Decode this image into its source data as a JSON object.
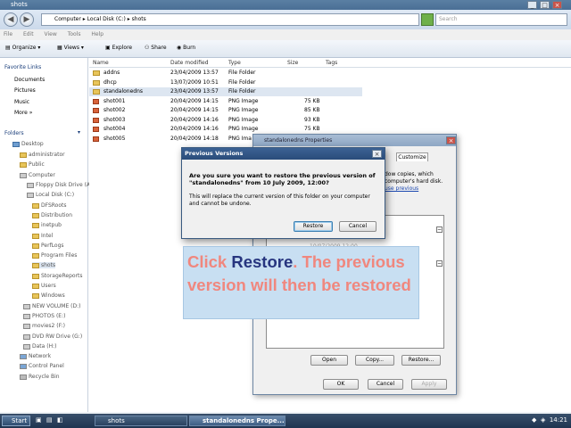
{
  "window": {
    "title": "shots"
  },
  "address": {
    "path": [
      "Computer",
      "Local Disk (C:)",
      "shots"
    ],
    "search_placeholder": "Search"
  },
  "menu": [
    "File",
    "Edit",
    "View",
    "Tools",
    "Help"
  ],
  "toolbar": {
    "organize": "Organize",
    "views": "Views",
    "explore": "Explore",
    "share": "Share",
    "burn": "Burn"
  },
  "sidebar": {
    "favorites_title": "Favorite Links",
    "favorites": [
      "Documents",
      "Pictures",
      "Music"
    ],
    "more": "More",
    "folders_title": "Folders",
    "tree": [
      "Desktop",
      "administrator",
      "Public",
      "Computer",
      "Floppy Disk Drive (A:)",
      "Local Disk (C:)",
      "DFSRoots",
      "Distribution",
      "inetpub",
      "Intel",
      "PerfLogs",
      "Program Files",
      "shots",
      "StorageReports",
      "Users",
      "Windows",
      "NEW VOLUME (D:)",
      "PHOTOS (E:)",
      "movies2 (F:)",
      "DVD RW Drive (G:)",
      "Data (H:)",
      "Network",
      "Control Panel",
      "Recycle Bin"
    ]
  },
  "columns": {
    "name": "Name",
    "date": "Date modified",
    "type": "Type",
    "size": "Size",
    "tags": "Tags"
  },
  "files": [
    {
      "name": "addns",
      "date": "23/04/2009 13:57",
      "type": "File Folder",
      "size": ""
    },
    {
      "name": "dhcp",
      "date": "13/07/2009 10:51",
      "type": "File Folder",
      "size": ""
    },
    {
      "name": "standalonedns",
      "date": "23/04/2009 13:57",
      "type": "File Folder",
      "size": ""
    },
    {
      "name": "shot001",
      "date": "20/04/2009 14:15",
      "type": "PNG Image",
      "size": "75 KB"
    },
    {
      "name": "shot002",
      "date": "20/04/2009 14:15",
      "type": "PNG Image",
      "size": "85 KB"
    },
    {
      "name": "shot003",
      "date": "20/04/2009 14:16",
      "type": "PNG Image",
      "size": "93 KB"
    },
    {
      "name": "shot004",
      "date": "20/04/2009 14:16",
      "type": "PNG Image",
      "size": "75 KB"
    },
    {
      "name": "shot005",
      "date": "20/04/2009 14:18",
      "type": "PNG Ima",
      "size": ""
    }
  ],
  "props_dialog": {
    "title": "standalonedns Properties",
    "tab_customize": "Customize",
    "partial_1": "dow copies, which",
    "partial_2": "computer's hard disk.",
    "partial_3": "use previous",
    "partial_date": "10/07/2009 12:00",
    "buttons": {
      "open": "Open",
      "copy": "Copy...",
      "restore": "Restore...",
      "ok": "OK",
      "cancel": "Cancel",
      "apply": "Apply"
    }
  },
  "prev_dialog": {
    "title": "Previous Versions",
    "question": "Are you sure you want to restore the previous version of \"standalonedns\" from 10 July 2009, 12:00?",
    "info": "This will replace the current version of this folder on your computer and cannot be undone.",
    "restore": "Restore",
    "cancel": "Cancel"
  },
  "callout": {
    "click": "Click ",
    "restore": "Restore",
    "rest": ". The previous version will then be restored"
  },
  "taskbar": {
    "start": "Start",
    "items": [
      "shots",
      "standalonedns Prope..."
    ],
    "clock": "14:21"
  },
  "colors": {
    "callout_bg": "#c8dff2",
    "callout_text": "#f0877e",
    "callout_highlight": "#27357f",
    "title_active": "#2a4c7a"
  }
}
